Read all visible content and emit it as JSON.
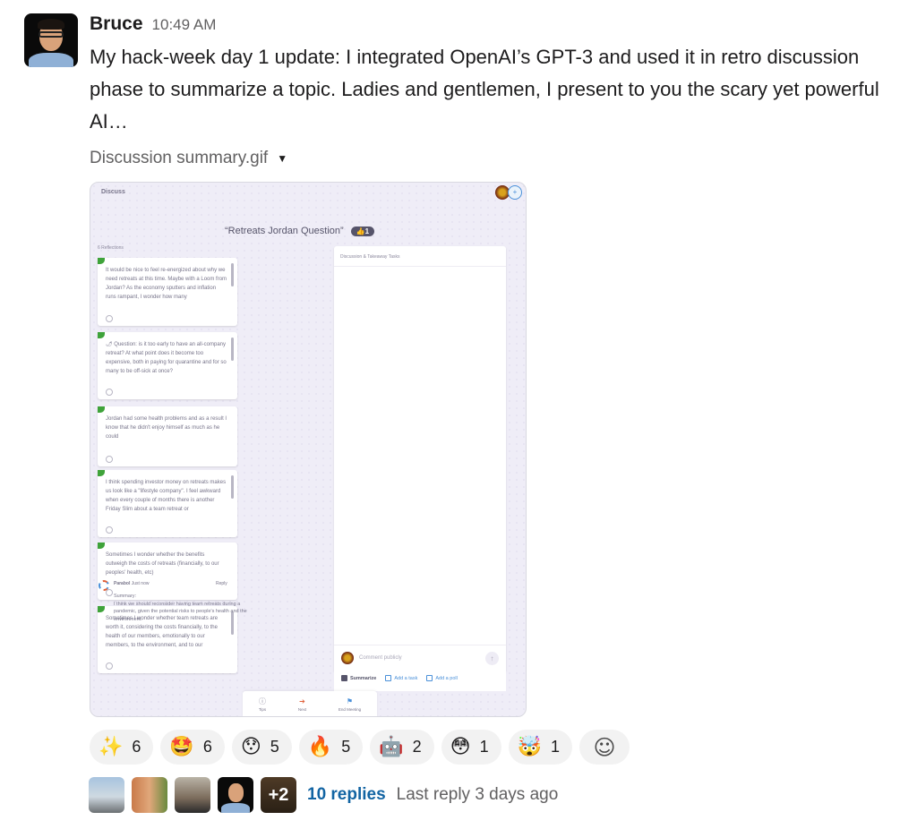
{
  "message": {
    "author": "Bruce",
    "time": "10:49 AM",
    "text": "My hack-week day 1 update: I integrated OpenAI’s GPT-3 and used it in retro discussion phase to summarize a topic. Ladies and gentlemen, I present to you the scary yet powerful AI…",
    "file_name": "Discussion summary.gif",
    "file_caret": "▼"
  },
  "gif": {
    "phase": "Discuss",
    "topic": "“Retreats Jordan Question”",
    "vote_label": "👍1",
    "reflections_label": "6 Reflections",
    "reflections": [
      {
        "text": "It would be nice to feel re-energized about why we need retreats at this time. Maybe with a Loom from Jordan? As the economy sputters and inflation runs rampant, I wonder how many"
      },
      {
        "text": "🌶 Question: is it too early to have an all-company retreat? At what point does it become too expensive, both in paying for quarantine and for so many to be off-sick at once?"
      },
      {
        "text": "Jordan had some health problems and as a result I know that he didn't enjoy himself as much as he could"
      },
      {
        "text": "I think spending investor money on retreats makes us look like a \"lifestyle company\". I feel awkward when every couple of months there is another Friday Slim about a team retreat or"
      },
      {
        "text": "Sometimes I wonder whether the benefits outweigh the costs of retreats (financially, to our peoples' health, etc)"
      },
      {
        "text": "Sometimes I wonder whether team retreats are worth it, considering the costs financially, to the health of our members, emotionally to our members, to the environment, and to our"
      }
    ],
    "discussion_title": "Discussion & Takeaway Tasks",
    "bot_name": "Parabol",
    "bot_time": "Just now",
    "reply_label": "Reply",
    "summary_heading": "Summary:",
    "summary_text": "I think we should reconsider having team retreats during a pandemic, given the potential risks to people's health and the environment.",
    "comment_placeholder": "Comment publicly",
    "actions": {
      "summarize": "Summarize",
      "add_task": "Add a task",
      "add_poll": "Add a poll"
    },
    "bottom_bar": {
      "tips": "Tips",
      "next": "Next",
      "end": "End Meeting"
    }
  },
  "reactions": [
    {
      "emoji": "✨",
      "name": "sparkles",
      "count": "6"
    },
    {
      "emoji": "🤩",
      "name": "star-struck",
      "count": "6"
    },
    {
      "emoji": "😯",
      "name": "hushed",
      "count": "5"
    },
    {
      "emoji": "🔥",
      "name": "fire",
      "count": "5"
    },
    {
      "emoji": "🤖",
      "name": "robot",
      "count": "2"
    },
    {
      "emoji": "😳",
      "name": "flushed",
      "count": "1"
    },
    {
      "emoji": "🤯",
      "name": "exploding-head",
      "count": "1"
    }
  ],
  "add_reaction_icon": "☺",
  "thread": {
    "more_participants": "+2",
    "replies": "10 replies",
    "last_reply": "Last reply 3 days ago"
  }
}
